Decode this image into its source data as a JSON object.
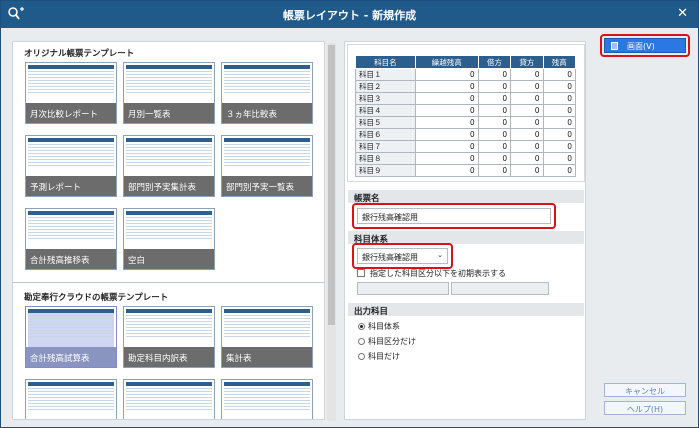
{
  "window": {
    "title": "帳票レイアウト - 新規作成",
    "close": "✕"
  },
  "left": {
    "section1_title": "オリジナル帳票テンプレート",
    "section1_cards": [
      "月次比較レポート",
      "月別一覧表",
      "３ヵ年比較表",
      "予測レポート",
      "部門別予実集計表",
      "部門別予実一覧表",
      "合計残高推移表",
      "空白"
    ],
    "section2_title": "勘定奉行クラウドの帳票テンプレート",
    "section2_cards": [
      "合計残高試算表",
      "勘定科目内訳表",
      "集計表"
    ]
  },
  "preview": {
    "headers": [
      "科目名",
      "繰越残高",
      "借方",
      "貸方",
      "残高"
    ],
    "rows": [
      [
        "科目１",
        "0",
        "0",
        "0",
        "0"
      ],
      [
        "科目２",
        "0",
        "0",
        "0",
        "0"
      ],
      [
        "科目３",
        "0",
        "0",
        "0",
        "0"
      ],
      [
        "科目４",
        "0",
        "0",
        "0",
        "0"
      ],
      [
        "科目５",
        "0",
        "0",
        "0",
        "0"
      ],
      [
        "科目６",
        "0",
        "0",
        "0",
        "0"
      ],
      [
        "科目７",
        "0",
        "0",
        "0",
        "0"
      ],
      [
        "科目８",
        "0",
        "0",
        "0",
        "0"
      ],
      [
        "科目９",
        "0",
        "0",
        "0",
        "0"
      ]
    ]
  },
  "form": {
    "report_name_label": "帳票名",
    "report_name_value": "銀行残高確認用",
    "account_system_label": "科目体系",
    "account_system_value": "銀行残高確認用",
    "initial_display_checkbox": "指定した科目区分以下を初期表示する",
    "output_label": "出力科目",
    "output_options": [
      "科目体系",
      "科目区分だけ",
      "科目だけ"
    ]
  },
  "buttons": {
    "screen": "画面(V)",
    "cancel": "キャンセル",
    "help": "ヘルプ(H)"
  }
}
